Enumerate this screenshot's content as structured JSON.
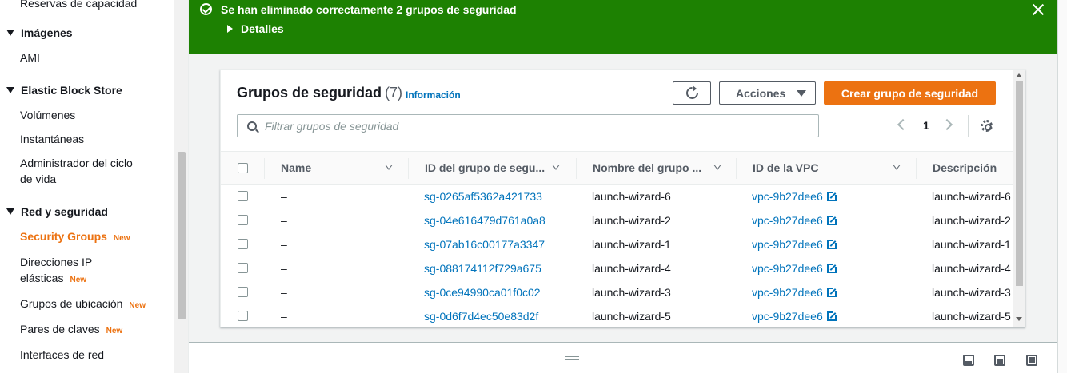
{
  "sidebar": {
    "partial_top_item": "Reservas de capacidad",
    "sections": [
      {
        "title": "Imágenes",
        "items": [
          {
            "label": "AMI"
          }
        ]
      },
      {
        "title": "Elastic Block Store",
        "items": [
          {
            "label": "Volúmenes"
          },
          {
            "label": "Instantáneas"
          },
          {
            "label": "Administrador del ciclo",
            "label2": "de vida"
          }
        ]
      },
      {
        "title": "Red y seguridad",
        "items": [
          {
            "label": "Security Groups",
            "badge": "New",
            "active": true
          },
          {
            "label": "Direcciones IP",
            "label2": "elásticas",
            "badge": "New"
          },
          {
            "label": "Grupos de ubicación",
            "badge": "New"
          },
          {
            "label": "Pares de claves",
            "badge": "New"
          },
          {
            "label": "Interfaces de red"
          }
        ]
      }
    ]
  },
  "flash": {
    "message": "Se han eliminado correctamente 2 grupos de seguridad",
    "details_label": "Detalles",
    "color": "#1d8102"
  },
  "panel": {
    "title": "Grupos de seguridad",
    "count": "(7)",
    "info_link": "Información",
    "actions_label": "Acciones",
    "create_label": "Crear grupo de seguridad",
    "search_placeholder": "Filtrar grupos de seguridad",
    "page": "1",
    "accent": "#ec7211"
  },
  "table": {
    "headers": [
      "Name",
      "ID del grupo de segu...",
      "Nombre del grupo ...",
      "ID de la VPC",
      "Descripción"
    ],
    "rows": [
      {
        "name": "–",
        "id": "sg-0265af5362a421733",
        "group": "launch-wizard-6",
        "vpc": "vpc-9b27dee6",
        "desc": "launch-wizard-6"
      },
      {
        "name": "–",
        "id": "sg-04e616479d761a0a8",
        "group": "launch-wizard-2",
        "vpc": "vpc-9b27dee6",
        "desc": "launch-wizard-2"
      },
      {
        "name": "–",
        "id": "sg-07ab16c00177a3347",
        "group": "launch-wizard-1",
        "vpc": "vpc-9b27dee6",
        "desc": "launch-wizard-1"
      },
      {
        "name": "–",
        "id": "sg-088174112f729a675",
        "group": "launch-wizard-4",
        "vpc": "vpc-9b27dee6",
        "desc": "launch-wizard-4"
      },
      {
        "name": "–",
        "id": "sg-0ce94990ca01f0c02",
        "group": "launch-wizard-3",
        "vpc": "vpc-9b27dee6",
        "desc": "launch-wizard-3"
      },
      {
        "name": "–",
        "id": "sg-0d6f7d4ec50e83d2f",
        "group": "launch-wizard-5",
        "vpc": "vpc-9b27dee6",
        "desc": "launch-wizard-5"
      }
    ]
  }
}
